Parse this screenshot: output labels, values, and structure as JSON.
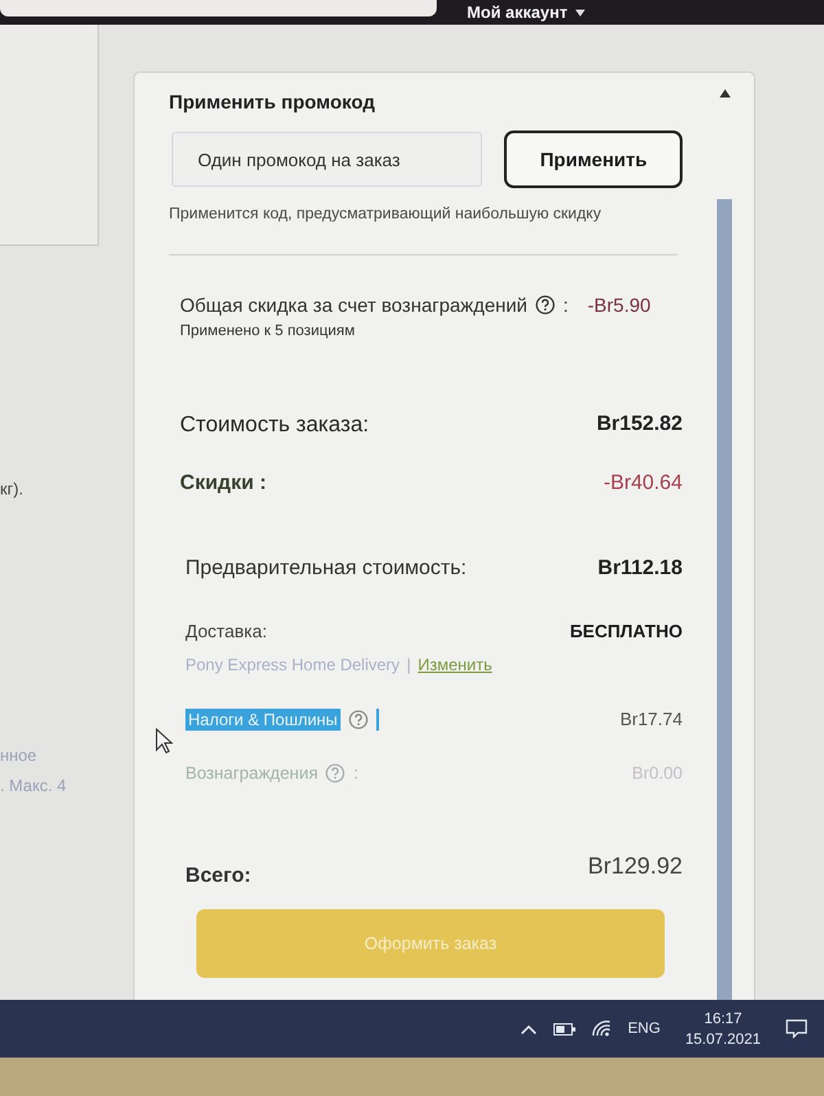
{
  "top_bar": {
    "account_menu": "Мой аккаунт"
  },
  "left_column": {
    "texts": [
      "кг).",
      "нное",
      ". Макс. 4"
    ]
  },
  "promo": {
    "title": "Применить промокод",
    "field": {
      "placeholder": "Один промокод на заказ"
    },
    "apply_button": "Применить",
    "hint": "Применится код, предусматривающий наибольшую скидку"
  },
  "rewards_discount": {
    "label": "Общая скидка за счет вознаграждений",
    "colon": ":",
    "value": "-Br5.90",
    "note": "Применено к 5 позициям"
  },
  "order_cost": {
    "label": "Стоимость заказа:",
    "value": "Br152.82"
  },
  "discounts": {
    "label": "Скидки :",
    "value": "-Br40.64"
  },
  "pre_total": {
    "label": "Предварительная стоимость:",
    "value": "Br112.18"
  },
  "delivery": {
    "label": "Доставка:",
    "value": "БЕСПЛАТНО",
    "method": "Pony Express Home Delivery",
    "separator": "|",
    "change_link": "Изменить"
  },
  "taxes": {
    "label": "Налоги & Пошлины",
    "highlighted": true,
    "value": "Br17.74"
  },
  "rewards": {
    "label": "Вознаграждения",
    "colon": ":",
    "value": "Br0.00"
  },
  "total": {
    "label": "Всего:",
    "value": "Br129.92"
  },
  "checkout_button": {
    "label": "Оформить заказ"
  },
  "taskbar": {
    "language": "ENG",
    "time": "16:17",
    "date": "15.07.2021"
  }
}
